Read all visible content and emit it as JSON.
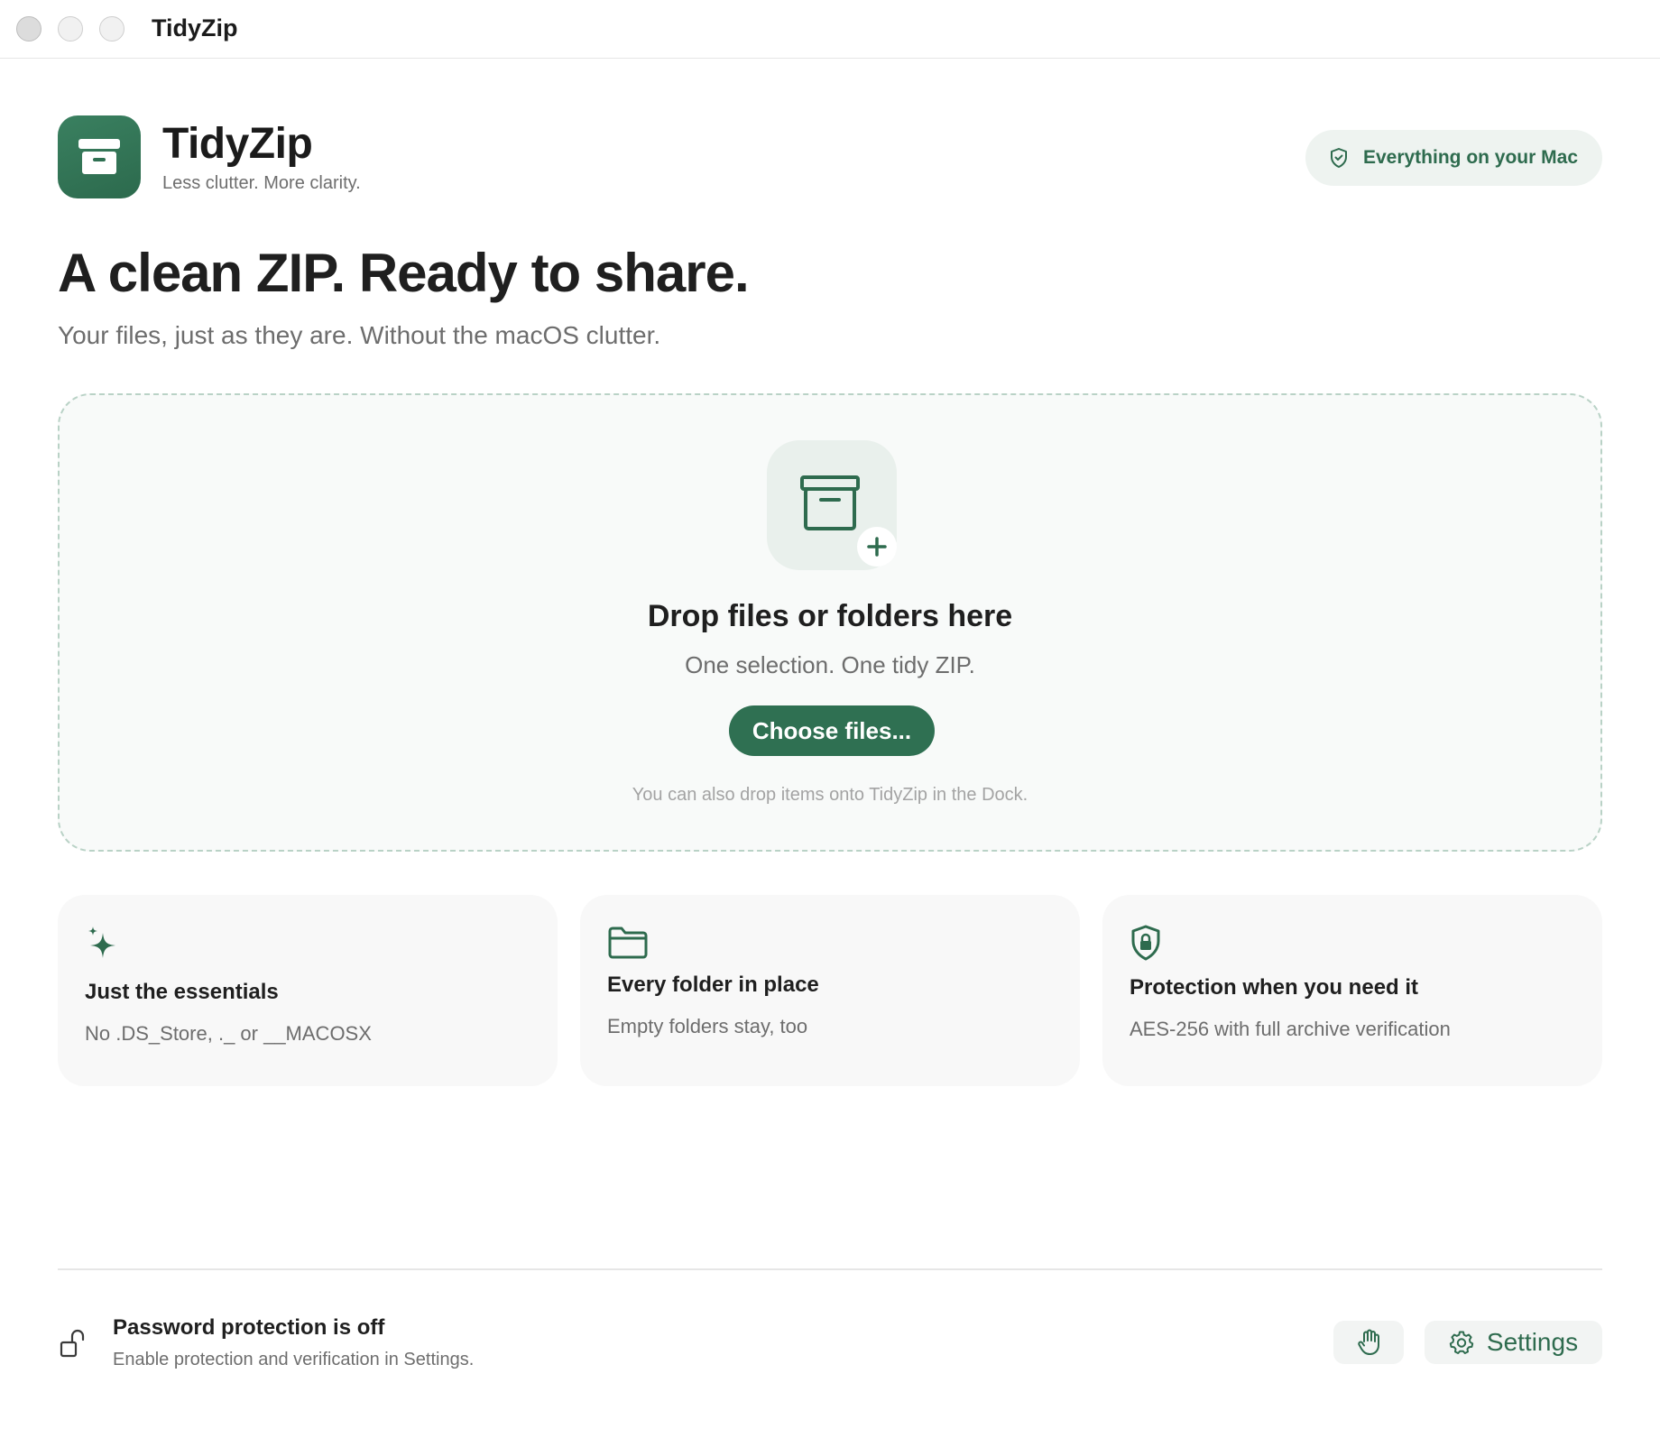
{
  "window": {
    "title": "TidyZip"
  },
  "header": {
    "app_name": "TidyZip",
    "tagline": "Less clutter. More clarity.",
    "badge_label": "Everything on your Mac",
    "badge_icon": "shield-check-icon"
  },
  "hero": {
    "title": "A clean ZIP. Ready to share.",
    "subtitle": "Your files, just as they are. Without the macOS clutter."
  },
  "dropzone": {
    "icon": "archive-box-plus-icon",
    "title": "Drop files or folders here",
    "subtitle": "One selection. One tidy ZIP.",
    "button_label": "Choose files...",
    "hint": "You can also drop items onto TidyZip in the Dock."
  },
  "features": [
    {
      "icon": "sparkles-icon",
      "title": "Just the essentials",
      "description": "No .DS_Store, ._ or __MACOSX"
    },
    {
      "icon": "folder-icon",
      "title": "Every folder in place",
      "description": "Empty folders stay, too"
    },
    {
      "icon": "shield-lock-icon",
      "title": "Protection when you need it",
      "description": "AES-256 with full archive verification"
    }
  ],
  "footer": {
    "icon": "unlock-icon",
    "title": "Password protection is off",
    "subtitle": "Enable protection and verification in Settings.",
    "hand_button_icon": "hand-icon",
    "settings_label": "Settings",
    "settings_icon": "gear-icon"
  },
  "colors": {
    "accent": "#2f7052",
    "accent_text": "#2e6b4e",
    "badge_bg": "#eef3f0",
    "dropzone_border": "#b9d2c6"
  }
}
